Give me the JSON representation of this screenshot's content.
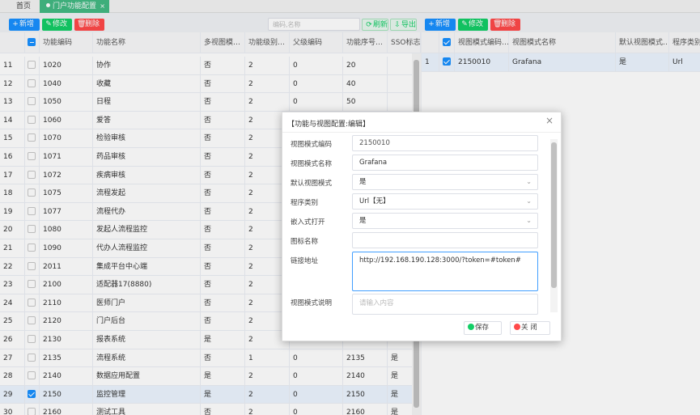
{
  "tabs": {
    "home": "首页",
    "portal": "门户功能配置",
    "close": "×"
  },
  "left_toolbar": {
    "add": "新增",
    "edit": "修改",
    "delete": "删除",
    "search_placeholder": "编码,名称",
    "refresh": "刷新",
    "export": "导出"
  },
  "right_toolbar": {
    "add": "新增",
    "edit": "修改",
    "delete": "删除"
  },
  "left_table": {
    "columns": [
      "",
      "",
      "功能编码",
      "功能名称",
      "多视图模…",
      "功能级别…",
      "父级编码",
      "功能序号…",
      "SSO标志…"
    ],
    "rows": [
      {
        "n": "11",
        "code": "1020",
        "name": "协作",
        "multi": "否",
        "level": "2",
        "parent": "0",
        "seq": "20",
        "sso": "",
        "checked": false
      },
      {
        "n": "12",
        "code": "1040",
        "name": "收藏",
        "multi": "否",
        "level": "2",
        "parent": "0",
        "seq": "40",
        "sso": "",
        "checked": false
      },
      {
        "n": "13",
        "code": "1050",
        "name": "日程",
        "multi": "否",
        "level": "2",
        "parent": "0",
        "seq": "50",
        "sso": "",
        "checked": false
      },
      {
        "n": "14",
        "code": "1060",
        "name": "爱答",
        "multi": "否",
        "level": "2",
        "parent": "",
        "seq": "",
        "sso": "",
        "checked": false
      },
      {
        "n": "15",
        "code": "1070",
        "name": "检验审核",
        "multi": "否",
        "level": "2",
        "parent": "",
        "seq": "",
        "sso": "",
        "checked": false
      },
      {
        "n": "16",
        "code": "1071",
        "name": "药品审核",
        "multi": "否",
        "level": "2",
        "parent": "",
        "seq": "",
        "sso": "",
        "checked": false
      },
      {
        "n": "17",
        "code": "1072",
        "name": "疾病审核",
        "multi": "否",
        "level": "2",
        "parent": "",
        "seq": "",
        "sso": "",
        "checked": false
      },
      {
        "n": "18",
        "code": "1075",
        "name": "流程发起",
        "multi": "否",
        "level": "2",
        "parent": "",
        "seq": "",
        "sso": "",
        "checked": false
      },
      {
        "n": "19",
        "code": "1077",
        "name": "流程代办",
        "multi": "否",
        "level": "2",
        "parent": "",
        "seq": "",
        "sso": "",
        "checked": false
      },
      {
        "n": "20",
        "code": "1080",
        "name": "发起人流程监控",
        "multi": "否",
        "level": "2",
        "parent": "",
        "seq": "",
        "sso": "",
        "checked": false
      },
      {
        "n": "21",
        "code": "1090",
        "name": "代办人流程监控",
        "multi": "否",
        "level": "2",
        "parent": "",
        "seq": "",
        "sso": "",
        "checked": false
      },
      {
        "n": "22",
        "code": "2011",
        "name": "集成平台中心端",
        "multi": "否",
        "level": "2",
        "parent": "",
        "seq": "",
        "sso": "",
        "checked": false
      },
      {
        "n": "23",
        "code": "2100",
        "name": "适配器17(8880)",
        "multi": "否",
        "level": "2",
        "parent": "",
        "seq": "",
        "sso": "",
        "checked": false
      },
      {
        "n": "24",
        "code": "2110",
        "name": "医师门户",
        "multi": "否",
        "level": "2",
        "parent": "",
        "seq": "",
        "sso": "",
        "checked": false
      },
      {
        "n": "25",
        "code": "2120",
        "name": "门户后台",
        "multi": "否",
        "level": "2",
        "parent": "",
        "seq": "",
        "sso": "",
        "checked": false
      },
      {
        "n": "26",
        "code": "2130",
        "name": "报表系统",
        "multi": "是",
        "level": "2",
        "parent": "",
        "seq": "",
        "sso": "",
        "checked": false
      },
      {
        "n": "27",
        "code": "2135",
        "name": "流程系统",
        "multi": "否",
        "level": "1",
        "parent": "0",
        "seq": "2135",
        "sso": "是",
        "checked": false
      },
      {
        "n": "28",
        "code": "2140",
        "name": "数据应用配置",
        "multi": "是",
        "level": "2",
        "parent": "0",
        "seq": "2140",
        "sso": "是",
        "checked": false
      },
      {
        "n": "29",
        "code": "2150",
        "name": "监控管理",
        "multi": "是",
        "level": "2",
        "parent": "0",
        "seq": "2150",
        "sso": "是",
        "checked": true
      },
      {
        "n": "30",
        "code": "2160",
        "name": "测试工具",
        "multi": "否",
        "level": "2",
        "parent": "0",
        "seq": "2160",
        "sso": "是",
        "checked": false
      }
    ]
  },
  "right_table": {
    "columns": [
      "",
      "",
      "视图模式编码…",
      "视图模式名称",
      "默认视图模式…",
      "程序类别"
    ],
    "rows": [
      {
        "n": "1",
        "code": "2150010",
        "name": "Grafana",
        "default": "是",
        "type": "Url",
        "checked": true
      }
    ]
  },
  "dialog": {
    "title": "【功能与视图配置:编辑】",
    "close": "×",
    "fields": {
      "code_label": "视图模式编码",
      "code_value": "2150010",
      "name_label": "视图模式名称",
      "name_value": "Grafana",
      "default_label": "默认视图模式",
      "default_value": "是",
      "type_label": "程序类别",
      "type_value": "Url【无】",
      "embed_label": "嵌入式打开",
      "embed_value": "是",
      "icon_label": "图标名称",
      "icon_value": "",
      "url_label": "链接地址",
      "url_value": "http://192.168.190.128:3000/?token=#token#",
      "desc_label": "视图模式说明",
      "desc_placeholder": "请输入内容"
    },
    "save": "保存",
    "close_btn": "关 闭"
  },
  "colors": {
    "primary": "#1890ff",
    "success": "#13ce66",
    "danger": "#ff4949",
    "tab_active": "#42b983"
  }
}
